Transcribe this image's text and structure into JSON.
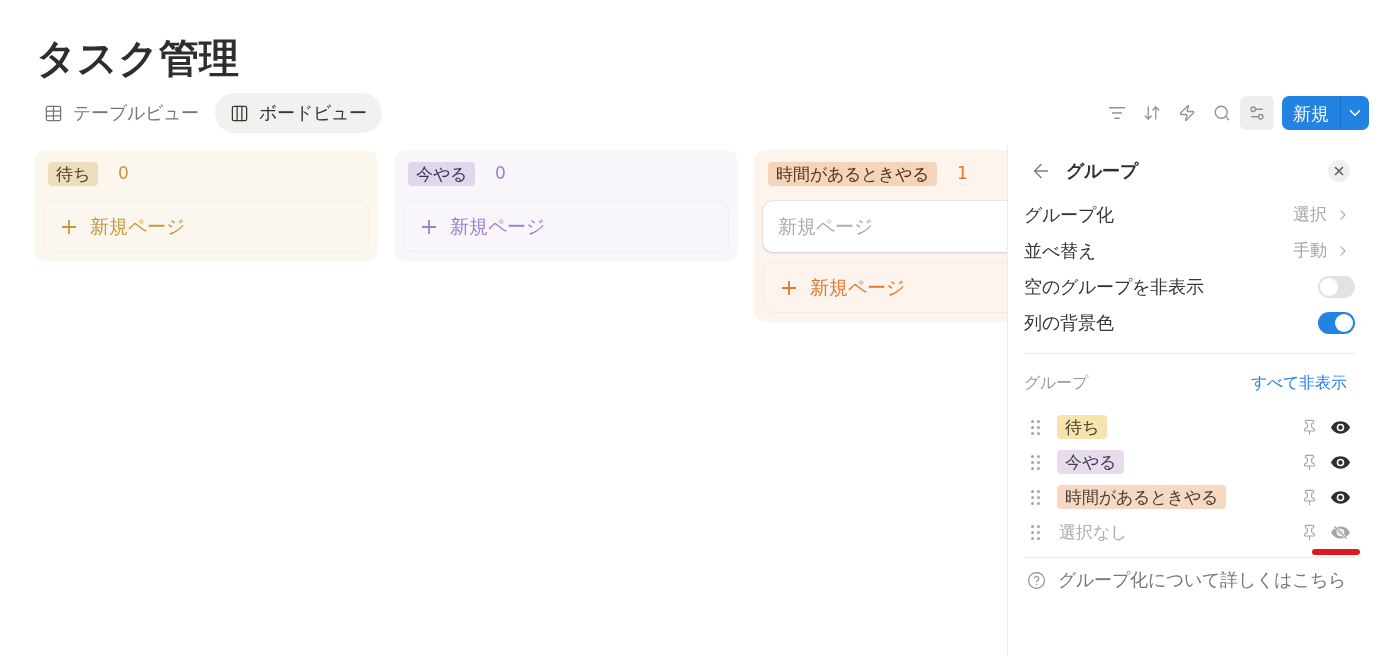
{
  "page": {
    "title": "タスク管理"
  },
  "views": [
    {
      "kind": "table",
      "label": "テーブルビュー",
      "selected": false
    },
    {
      "kind": "board",
      "label": "ボードビュー",
      "selected": true
    }
  ],
  "toolbar": {
    "tools": [
      {
        "kind": "filter",
        "selected": false
      },
      {
        "kind": "sort",
        "selected": false
      },
      {
        "kind": "automation",
        "selected": false
      },
      {
        "kind": "search",
        "selected": false
      },
      {
        "kind": "settings",
        "selected": true
      }
    ],
    "new_button": {
      "label": "新規"
    }
  },
  "board": {
    "columns": [
      {
        "label": "待ち",
        "count": "0",
        "color": "#c9973a",
        "add_label": "新規ページ"
      },
      {
        "label": "今やる",
        "count": "0",
        "color": "#a37fc7",
        "add_label": "新規ページ"
      },
      {
        "label": "時間があるときやる",
        "count": "1",
        "color": "#e0782f",
        "cards": [
          {
            "placeholder": "新規ページ"
          }
        ],
        "add_label": "新規ページ"
      }
    ]
  },
  "panel": {
    "title": "グループ",
    "settings": [
      {
        "kind": "select",
        "label": "グループ化",
        "value": "選択"
      },
      {
        "kind": "select",
        "label": "並べ替え",
        "value": "手動"
      },
      {
        "kind": "toggle",
        "label": "空のグループを非表示",
        "on": false
      },
      {
        "kind": "toggle",
        "label": "列の背景色",
        "on": true
      }
    ],
    "groups_heading": "グループ",
    "hide_all": "すべて非表示",
    "groups": [
      {
        "kind": "tag",
        "label": "待ち",
        "color": "#f6e3ad",
        "pinned": false,
        "visible": true,
        "highlighted": false
      },
      {
        "kind": "tag",
        "label": "今やる",
        "color": "#e8dbee",
        "pinned": false,
        "visible": true,
        "highlighted": false
      },
      {
        "kind": "tag",
        "label": "時間があるときやる",
        "color": "#f7d8c3",
        "pinned": false,
        "visible": true,
        "highlighted": false
      },
      {
        "kind": "none",
        "label": "選択なし",
        "pinned": false,
        "visible": false,
        "highlighted": true
      }
    ],
    "help": "グループ化について詳しくはこちら"
  }
}
